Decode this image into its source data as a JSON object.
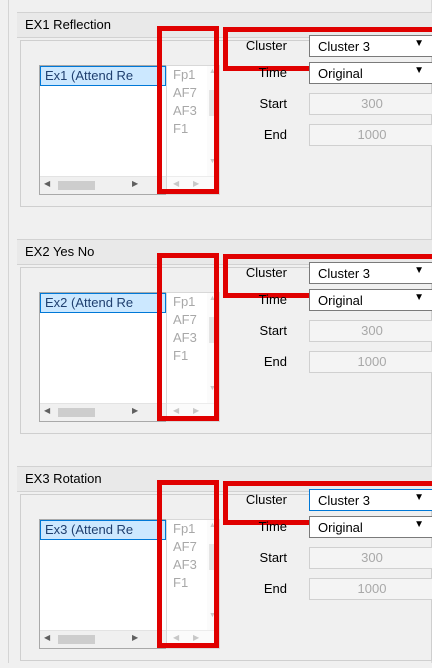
{
  "panels": [
    {
      "title": "EX1 Reflection",
      "list_selected": "Ex1 (Attend Re",
      "channels": [
        "Fp1",
        "AF7",
        "AF3",
        "F1"
      ],
      "cluster_label": "Cluster",
      "cluster_value": "Cluster 3",
      "time_label": "Time",
      "time_value": "Original",
      "start_label": "Start",
      "start_value": "300",
      "end_label": "End",
      "end_value": "1000"
    },
    {
      "title": "EX2 Yes No",
      "list_selected": "Ex2 (Attend Re",
      "channels": [
        "Fp1",
        "AF7",
        "AF3",
        "F1"
      ],
      "cluster_label": "Cluster",
      "cluster_value": "Cluster 3",
      "time_label": "Time",
      "time_value": "Original",
      "start_label": "Start",
      "start_value": "300",
      "end_label": "End",
      "end_value": "1000"
    },
    {
      "title": "EX3 Rotation",
      "list_selected": "Ex3 (Attend Re",
      "channels": [
        "Fp1",
        "AF7",
        "AF3",
        "F1"
      ],
      "cluster_label": "Cluster",
      "cluster_value": "Cluster 3",
      "time_label": "Time",
      "time_value": "Original",
      "start_label": "Start",
      "start_value": "300",
      "end_label": "End",
      "end_value": "1000"
    }
  ],
  "icons": {
    "dropdown_arrow": "▼",
    "scroll_left": "◀",
    "scroll_right": "▶",
    "scroll_up": "▲",
    "scroll_down": "▼"
  },
  "colors": {
    "highlight_box": "#e00000",
    "selection_bg": "#cce8ff",
    "selection_border": "#0078d7"
  }
}
